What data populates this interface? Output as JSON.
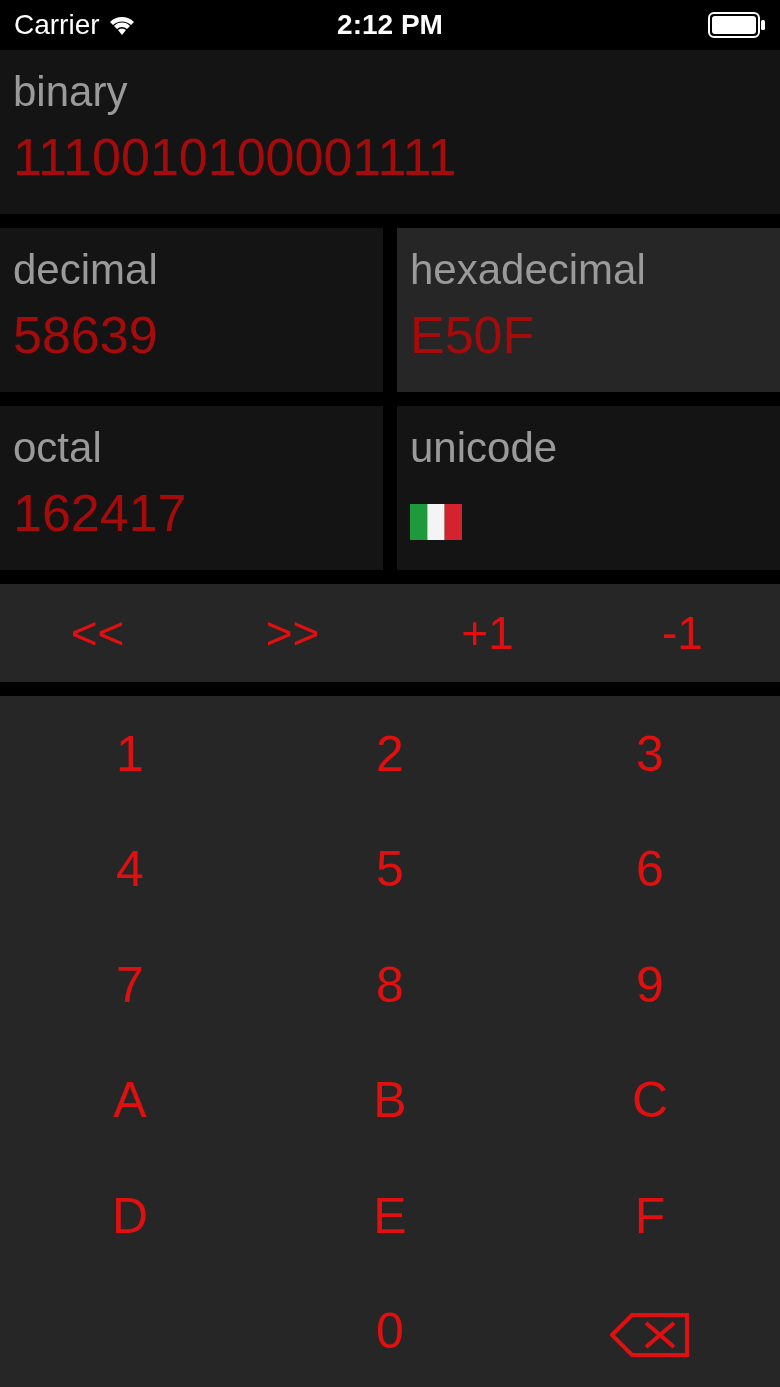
{
  "status_bar": {
    "carrier": "Carrier",
    "time": "2:12 PM"
  },
  "binary": {
    "label": "binary",
    "value": "1110010100001111",
    "selected": false
  },
  "fields": [
    {
      "label": "decimal",
      "value": "58639",
      "selected": false,
      "kind": "text"
    },
    {
      "label": "hexadecimal",
      "value": "E50F",
      "selected": true,
      "kind": "text"
    },
    {
      "label": "octal",
      "value": "162417",
      "selected": false,
      "kind": "text"
    },
    {
      "label": "unicode",
      "selected": false,
      "kind": "flag"
    }
  ],
  "operations": [
    "<<",
    ">>",
    "+1",
    "-1"
  ],
  "keys": [
    {
      "kind": "digit",
      "label": "1"
    },
    {
      "kind": "digit",
      "label": "2"
    },
    {
      "kind": "digit",
      "label": "3"
    },
    {
      "kind": "digit",
      "label": "4"
    },
    {
      "kind": "digit",
      "label": "5"
    },
    {
      "kind": "digit",
      "label": "6"
    },
    {
      "kind": "digit",
      "label": "7"
    },
    {
      "kind": "digit",
      "label": "8"
    },
    {
      "kind": "digit",
      "label": "9"
    },
    {
      "kind": "digit",
      "label": "A"
    },
    {
      "kind": "digit",
      "label": "B"
    },
    {
      "kind": "digit",
      "label": "C"
    },
    {
      "kind": "digit",
      "label": "D"
    },
    {
      "kind": "digit",
      "label": "E"
    },
    {
      "kind": "digit",
      "label": "F"
    },
    {
      "kind": "blank"
    },
    {
      "kind": "digit",
      "label": "0"
    },
    {
      "kind": "delete"
    }
  ]
}
